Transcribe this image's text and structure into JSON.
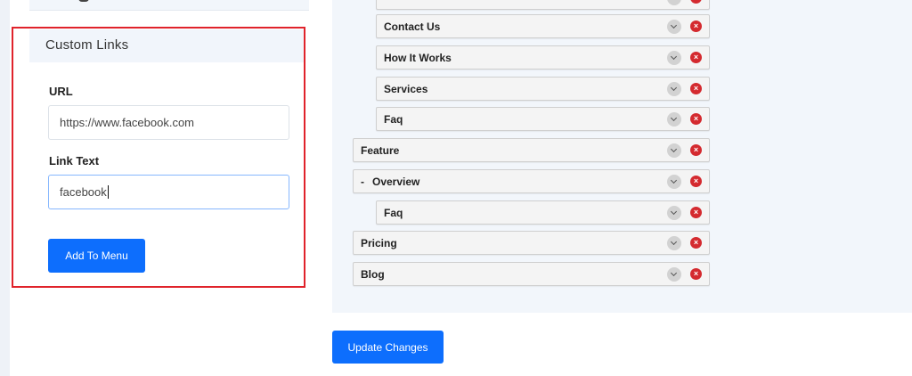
{
  "custom_links": {
    "title": "Custom Links",
    "url_label": "URL",
    "url_value": "https://www.facebook.com",
    "link_text_label": "Link Text",
    "link_text_value": "facebook",
    "add_button": "Add To Menu"
  },
  "menu": {
    "items": [
      {
        "label": "",
        "level": 1
      },
      {
        "label": "Contact Us",
        "level": 1
      },
      {
        "label": "How It Works",
        "level": 1
      },
      {
        "label": "Services",
        "level": 1
      },
      {
        "label": "Faq",
        "level": 1
      },
      {
        "label": "Feature",
        "level": 0
      },
      {
        "label": "Overview",
        "level": 0,
        "prefix": "-"
      },
      {
        "label": "Faq",
        "level": 1
      },
      {
        "label": "Pricing",
        "level": 0
      },
      {
        "label": "Blog",
        "level": 0
      }
    ],
    "delete_glyph": "×"
  },
  "update_button": "Update Changes",
  "colors": {
    "accent": "#0d6efd",
    "delete": "#d42a2f",
    "highlight": "#e0232b"
  }
}
